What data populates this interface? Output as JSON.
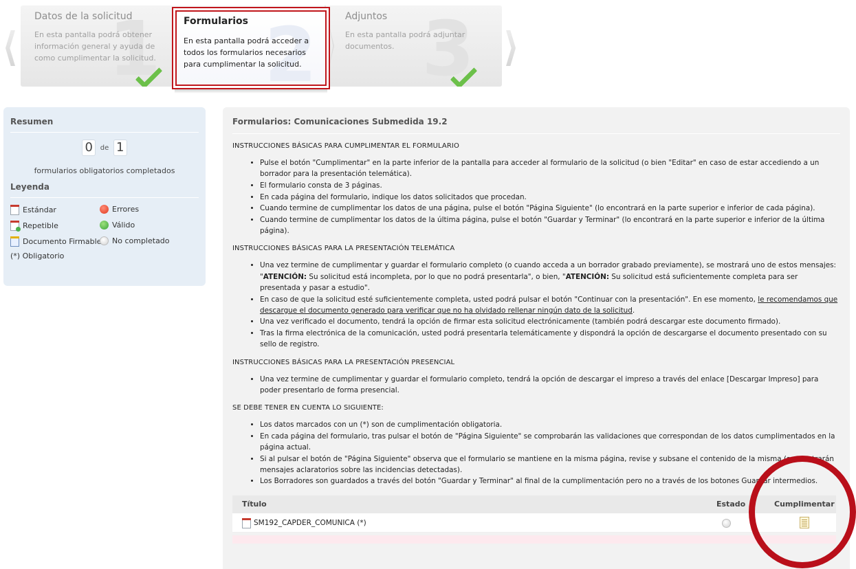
{
  "wizard": {
    "steps": [
      {
        "title": "Datos de la solicitud",
        "desc": "En esta pantalla podrá obtener información general y ayuda de como cumplimentar la solicitud.",
        "num": "1"
      },
      {
        "title": "Formularios",
        "desc": "En esta pantalla podrá acceder a todos los formularios necesarios para cumplimentar la solicitud.",
        "num": "2"
      },
      {
        "title": "Adjuntos",
        "desc": "En esta pantalla podrá adjuntar documentos.",
        "num": "3"
      }
    ]
  },
  "summary": {
    "title": "Resumen",
    "completed": "0",
    "de": "de",
    "total": "1",
    "label": "formularios obligatorios completados",
    "legend_title": "Leyenda",
    "legend": {
      "estandar": "Estándar",
      "errores": "Errores",
      "repetible": "Repetible",
      "valido": "Válido",
      "firmable": "Documento Firmable",
      "no_completado": "No completado"
    },
    "obligatorio": "(*) Obligatorio"
  },
  "main": {
    "title": "Formularios: Comunicaciones Submedida 19.2",
    "sec1": "INSTRUCCIONES BÁSICAS PARA CUMPLIMENTAR EL FORMULARIO",
    "sec1_items": [
      "Pulse el botón \"Cumplimentar\" en la parte inferior de la pantalla para acceder al formulario de la solicitud (o bien \"Editar\" en caso de estar accediendo a un borrador para la presentación telemática).",
      "El formulario consta de 3 páginas.",
      "En cada página del formulario, indique los datos solicitados que procedan.",
      "Cuando termine de cumplimentar los datos de una página, pulse el botón \"Página Siguiente\" (lo encontrará en la parte superior e inferior de cada página).",
      "Cuando termine de cumplimentar los datos de la última página, pulse el botón \"Guardar y Terminar\" (lo encontrará en la parte superior e inferior de la última página)."
    ],
    "sec2": "INSTRUCCIONES BÁSICAS PARA LA PRESENTACIÓN TELEMÁTICA",
    "sec2_item1_a": "Una vez termine de cumplimentar y guardar el formulario completo (o cuando acceda a un borrador grabado previamente), se mostrará uno de estos mensajes: \"",
    "sec2_item1_b": "ATENCIÓN:",
    "sec2_item1_c": " Su solicitud está incompleta, por lo que no podrá presentarla\", o bien, \"",
    "sec2_item1_d": "ATENCIÓN:",
    "sec2_item1_e": " Su solicitud está suficientemente completa para ser presentada y pasar a estudio\".",
    "sec2_item2_a": "En caso de que la solicitud esté suficientemente completa, usted podrá pulsar el botón \"Continuar con la presentación\". En ese momento, ",
    "sec2_item2_b": "le recomendamos que descargue el documento generado para verificar que no ha olvidado rellenar ningún dato de la solicitud",
    "sec2_item2_c": ".",
    "sec2_item3": "Una vez verificado el documento, tendrá la opción de firmar esta solicitud electrónicamente (también podrá descargar este documento firmado).",
    "sec2_item4": "Tras la firma electrónica de la comunicación, usted podrá presentarla telemáticamente y dispondrá la opción de descargarse el documento presentado con su sello de registro.",
    "sec3": "INSTRUCCIONES BÁSICAS PARA LA PRESENTACIÓN PRESENCIAL",
    "sec3_items": [
      "Una vez termine de cumplimentar y guardar el formulario completo, tendrá la opción de descargar el impreso a través del enlace [Descargar Impreso] para poder presentarlo de forma presencial."
    ],
    "sec4": "SE DEBE TENER EN CUENTA LO SIGUIENTE:",
    "sec4_items": [
      "Los datos marcados con un (*) son de cumplimentación obligatoria.",
      "En cada página del formulario, tras pulsar el botón de \"Página Siguiente\" se comprobarán las validaciones que correspondan de los datos cumplimentados en la página actual.",
      "Si al pulsar el botón de \"Página Siguiente\" observa que el formulario se mantiene en la misma página, revise y subsane el contenido de la misma (se mostrarán mensajes aclaratorios sobre las incidencias detectadas).",
      "Los Borradores son guardados a través del botón \"Guardar y Terminar\" al final de la cumplimentación pero no a través de los botones Guardar intermedios."
    ]
  },
  "table": {
    "col_title": "Título",
    "col_estado": "Estado",
    "col_cumplimentar": "Cumplimentar",
    "rows": [
      {
        "title": "SM192_CAPDER_COMUNICA (*)"
      }
    ]
  }
}
